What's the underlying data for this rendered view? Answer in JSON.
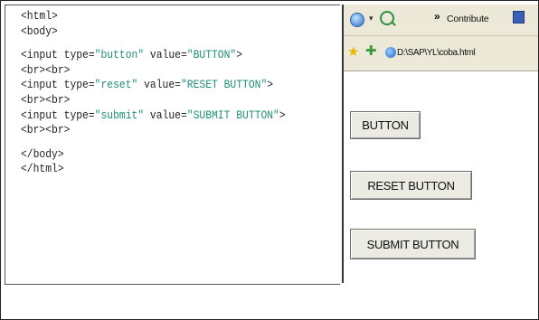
{
  "code": {
    "line_html_open": "<html>",
    "line_body_open": "<body>",
    "input1": {
      "pre": "<input type=",
      "type": "\"button\"",
      "mid": " value=",
      "value": "\"BUTTON\"",
      "end": ">"
    },
    "br1": "<br><br>",
    "input2": {
      "pre": "<input type=",
      "type": "\"reset\"",
      "mid": " value=",
      "value": "\"RESET BUTTON\"",
      "end": ">"
    },
    "br2": "<br><br>",
    "input3": {
      "pre": "<input type=",
      "type": "\"submit\"",
      "mid": " value=",
      "value": "\"SUBMIT BUTTON\"",
      "end": ">"
    },
    "br3": "<br><br>",
    "line_body_close": "</body>",
    "line_html_close": "</html>"
  },
  "browser": {
    "toolbar": {
      "dropdown_glyph": "▾",
      "chevrons": "»",
      "contribute_label": "Contribute",
      "icons": [
        "back-icon",
        "search-icon",
        "contribute-icon",
        "favorites-star-icon",
        "add-favorite-icon",
        "ie-page-icon"
      ]
    },
    "address": "D:\\SAP\\YL\\coba.html",
    "buttons": {
      "button_label": "BUTTON",
      "reset_label": "RESET BUTTON",
      "submit_label": "SUBMIT BUTTON"
    }
  },
  "colors": {
    "code_string": "#1f8f77",
    "code_text": "#1f1f1f",
    "toolbar_bg": "#ece9d8",
    "button_bg": "#ebeae3"
  }
}
